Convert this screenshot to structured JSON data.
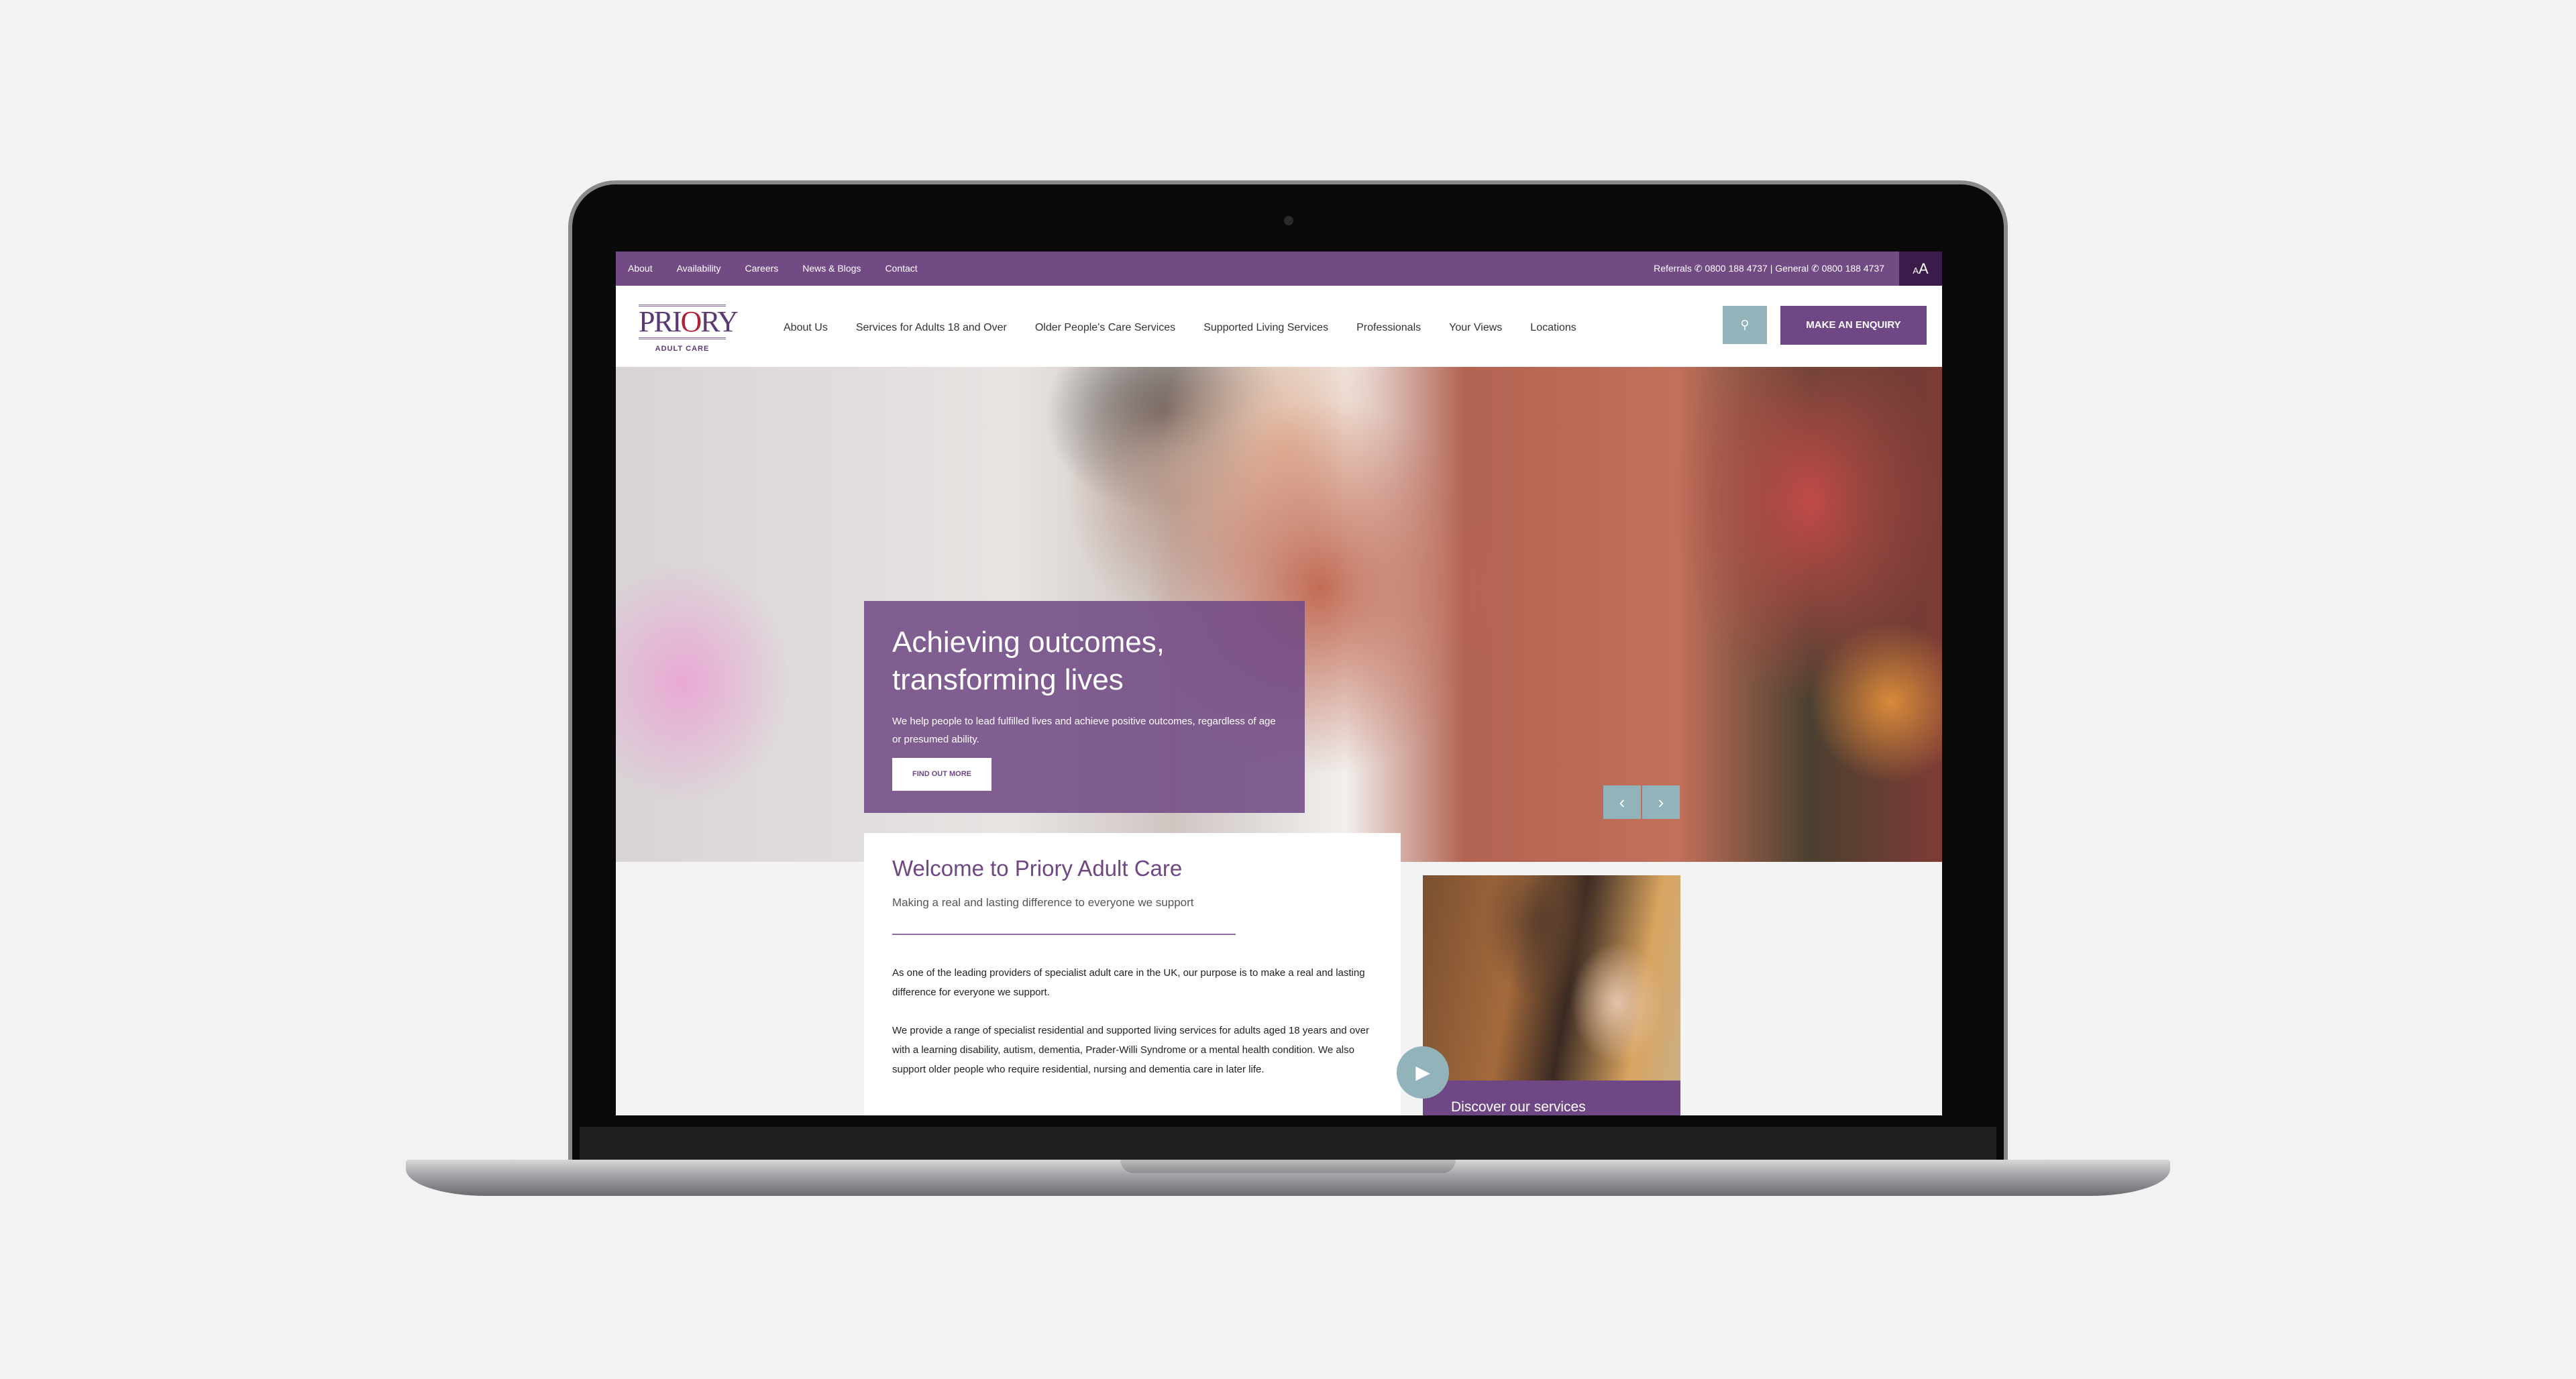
{
  "topbar": {
    "links": [
      "About",
      "Availability",
      "Careers",
      "News & Blogs",
      "Contact"
    ],
    "phones": "Referrals ✆ 0800 188 4737 | General ✆ 0800 188 4737",
    "text_size_small": "A",
    "text_size_large": "A"
  },
  "logo": {
    "word_a": "PRI",
    "word_b": "O",
    "word_c": "RY",
    "sub": "ADULT CARE"
  },
  "nav": {
    "items": [
      "About Us",
      "Services for Adults 18 and Over",
      "Older People's Care Services",
      "Supported Living Services",
      "Professionals",
      "Your Views",
      "Locations"
    ],
    "search_icon": "⚲",
    "enquiry": "MAKE AN ENQUIRY"
  },
  "hero": {
    "title_line1": "Achieving outcomes,",
    "title_line2": "transforming lives",
    "text": "We help people to lead fulfilled lives and achieve positive outcomes, regardless of age or presumed ability.",
    "button": "FIND OUT MORE",
    "prev": "‹",
    "next": "›"
  },
  "welcome": {
    "title": "Welcome to Priory Adult Care",
    "tagline": "Making a real and lasting difference to everyone we support",
    "p1": "As one of the leading providers of specialist adult care in the UK, our purpose is to make a real and lasting difference for everyone we support.",
    "p2": "We provide a range of specialist residential and supported living services for adults aged 18 years and over with a learning disability, autism, dementia, Prader-Willi Syndrome or a mental health condition. We also support older people who require residential, nursing and dementia care in later life."
  },
  "services": {
    "label": "Discover our services",
    "play": "▶"
  },
  "colors": {
    "brand_purple": "#724b85",
    "accent_teal": "#93b3bb",
    "dark_purple": "#3a1b4a"
  }
}
